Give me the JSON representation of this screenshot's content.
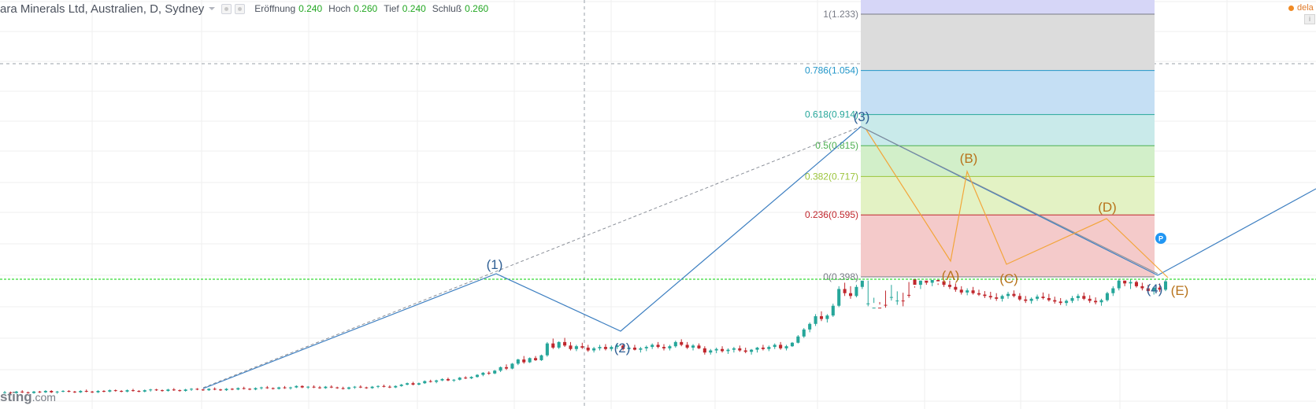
{
  "header": {
    "title": "ara Minerals Ltd, Australien, D, Sydney",
    "ohlc": [
      {
        "label": "Eröffnung",
        "value": "0.240"
      },
      {
        "label": "Hoch",
        "value": "0.260"
      },
      {
        "label": "Tief",
        "value": "0.240"
      },
      {
        "label": "Schluß",
        "value": "0.260"
      }
    ],
    "delay_text": "dela",
    "corner_icon": "info-icon"
  },
  "watermark": {
    "brand": "sting",
    "domain": ".com"
  },
  "colors": {
    "up": "#26a69a",
    "down": "#c0272d",
    "elliott": "#3d7fc1",
    "abcde": "#f3a53a",
    "price_line": "#00d000",
    "label_wave": "#2f5f94",
    "label_abcde": "#b8731b"
  },
  "chart_data": {
    "type": "candlestick",
    "price_axis": {
      "min": 0.0,
      "max": 1.3
    },
    "current_price": 0.26,
    "fibonacci": {
      "levels": [
        {
          "ratio": "1",
          "price": "1.233",
          "label": "1(1.233)",
          "color": "#787b86",
          "band": "#dcdcdc"
        },
        {
          "ratio": "0.786",
          "price": "1.054",
          "label": "0.786(1.054)",
          "color": "#2196c9",
          "band": "#c5dff4"
        },
        {
          "ratio": "0.618",
          "price": "0.914",
          "label": "0.618(0.914)",
          "color": "#26a69a",
          "band": "#c9eaea"
        },
        {
          "ratio": "0.5",
          "price": "0.815",
          "label": "0.5(0.815)",
          "color": "#4caf50",
          "band": "#d2efc9"
        },
        {
          "ratio": "0.382",
          "price": "0.717",
          "label": "0.382(0.717)",
          "color": "#9bc43b",
          "band": "#e3f2c4"
        },
        {
          "ratio": "0.236",
          "price": "0.595",
          "label": "0.236(0.595)",
          "color": "#c0272d",
          "band": "#f4caca"
        },
        {
          "ratio": "0",
          "price": "0.398",
          "label": "0(0.398)",
          "color": "#787b86",
          "band": ""
        }
      ],
      "top_band_color": "#d6d6f7"
    },
    "elliott_labels": [
      "(1)",
      "(2)",
      "(3)",
      "(4)"
    ],
    "abcde_labels": [
      "(A)",
      "(B)",
      "(C)",
      "(D)",
      "(E)"
    ],
    "marker": "P",
    "candles": [
      [
        0.098,
        0.1,
        0.096,
        0.098
      ],
      [
        0.098,
        0.099,
        0.095,
        0.097
      ],
      [
        0.097,
        0.1,
        0.096,
        0.099
      ],
      [
        0.099,
        0.101,
        0.097,
        0.098
      ],
      [
        0.098,
        0.099,
        0.096,
        0.097
      ],
      [
        0.097,
        0.1,
        0.096,
        0.099
      ],
      [
        0.099,
        0.1,
        0.097,
        0.098
      ],
      [
        0.098,
        0.101,
        0.097,
        0.1
      ],
      [
        0.1,
        0.101,
        0.097,
        0.098
      ],
      [
        0.098,
        0.1,
        0.096,
        0.099
      ],
      [
        0.099,
        0.101,
        0.098,
        0.1
      ],
      [
        0.1,
        0.101,
        0.098,
        0.099
      ],
      [
        0.099,
        0.1,
        0.097,
        0.098
      ],
      [
        0.098,
        0.101,
        0.097,
        0.1
      ],
      [
        0.1,
        0.102,
        0.098,
        0.099
      ],
      [
        0.099,
        0.1,
        0.097,
        0.098
      ],
      [
        0.098,
        0.101,
        0.097,
        0.1
      ],
      [
        0.1,
        0.101,
        0.098,
        0.099
      ],
      [
        0.099,
        0.102,
        0.098,
        0.101
      ],
      [
        0.101,
        0.102,
        0.099,
        0.1
      ],
      [
        0.1,
        0.101,
        0.098,
        0.099
      ],
      [
        0.099,
        0.102,
        0.098,
        0.101
      ],
      [
        0.101,
        0.103,
        0.099,
        0.1
      ],
      [
        0.1,
        0.101,
        0.098,
        0.099
      ],
      [
        0.099,
        0.102,
        0.098,
        0.101
      ],
      [
        0.101,
        0.103,
        0.099,
        0.102
      ],
      [
        0.102,
        0.103,
        0.1,
        0.101
      ],
      [
        0.101,
        0.102,
        0.099,
        0.1
      ],
      [
        0.1,
        0.103,
        0.099,
        0.102
      ],
      [
        0.102,
        0.104,
        0.1,
        0.101
      ],
      [
        0.101,
        0.102,
        0.099,
        0.1
      ],
      [
        0.1,
        0.103,
        0.099,
        0.102
      ],
      [
        0.102,
        0.104,
        0.1,
        0.103
      ],
      [
        0.103,
        0.104,
        0.101,
        0.102
      ],
      [
        0.102,
        0.103,
        0.1,
        0.101
      ],
      [
        0.101,
        0.104,
        0.1,
        0.103
      ],
      [
        0.103,
        0.105,
        0.101,
        0.102
      ],
      [
        0.102,
        0.103,
        0.1,
        0.101
      ],
      [
        0.101,
        0.104,
        0.1,
        0.103
      ],
      [
        0.103,
        0.104,
        0.101,
        0.102
      ],
      [
        0.102,
        0.105,
        0.101,
        0.104
      ],
      [
        0.104,
        0.106,
        0.102,
        0.103
      ],
      [
        0.103,
        0.104,
        0.101,
        0.102
      ],
      [
        0.102,
        0.105,
        0.101,
        0.104
      ],
      [
        0.104,
        0.106,
        0.102,
        0.105
      ],
      [
        0.105,
        0.107,
        0.103,
        0.104
      ],
      [
        0.104,
        0.105,
        0.102,
        0.103
      ],
      [
        0.103,
        0.106,
        0.102,
        0.105
      ],
      [
        0.105,
        0.107,
        0.103,
        0.104
      ],
      [
        0.104,
        0.106,
        0.102,
        0.105
      ],
      [
        0.105,
        0.108,
        0.104,
        0.107
      ],
      [
        0.107,
        0.108,
        0.104,
        0.105
      ],
      [
        0.105,
        0.107,
        0.103,
        0.106
      ],
      [
        0.106,
        0.108,
        0.104,
        0.105
      ],
      [
        0.105,
        0.107,
        0.103,
        0.104
      ],
      [
        0.104,
        0.107,
        0.103,
        0.106
      ],
      [
        0.106,
        0.108,
        0.104,
        0.105
      ],
      [
        0.105,
        0.106,
        0.103,
        0.104
      ],
      [
        0.104,
        0.106,
        0.102,
        0.103
      ],
      [
        0.103,
        0.106,
        0.102,
        0.105
      ],
      [
        0.105,
        0.107,
        0.103,
        0.106
      ],
      [
        0.106,
        0.108,
        0.104,
        0.105
      ],
      [
        0.105,
        0.106,
        0.103,
        0.104
      ],
      [
        0.104,
        0.107,
        0.103,
        0.106
      ],
      [
        0.106,
        0.108,
        0.104,
        0.107
      ],
      [
        0.107,
        0.109,
        0.105,
        0.106
      ],
      [
        0.106,
        0.108,
        0.104,
        0.105
      ],
      [
        0.105,
        0.108,
        0.104,
        0.107
      ],
      [
        0.107,
        0.11,
        0.106,
        0.109
      ],
      [
        0.109,
        0.112,
        0.108,
        0.111
      ],
      [
        0.111,
        0.113,
        0.108,
        0.109
      ],
      [
        0.109,
        0.112,
        0.108,
        0.111
      ],
      [
        0.111,
        0.115,
        0.11,
        0.114
      ],
      [
        0.114,
        0.116,
        0.112,
        0.113
      ],
      [
        0.113,
        0.116,
        0.111,
        0.115
      ],
      [
        0.115,
        0.118,
        0.114,
        0.117
      ],
      [
        0.117,
        0.119,
        0.114,
        0.115
      ],
      [
        0.115,
        0.117,
        0.113,
        0.116
      ],
      [
        0.116,
        0.12,
        0.115,
        0.119
      ],
      [
        0.119,
        0.121,
        0.117,
        0.118
      ],
      [
        0.118,
        0.121,
        0.117,
        0.12
      ],
      [
        0.12,
        0.124,
        0.119,
        0.123
      ],
      [
        0.123,
        0.127,
        0.121,
        0.126
      ],
      [
        0.126,
        0.128,
        0.123,
        0.125
      ],
      [
        0.125,
        0.13,
        0.124,
        0.129
      ],
      [
        0.129,
        0.135,
        0.127,
        0.134
      ],
      [
        0.134,
        0.138,
        0.13,
        0.132
      ],
      [
        0.132,
        0.14,
        0.131,
        0.139
      ],
      [
        0.139,
        0.146,
        0.137,
        0.145
      ],
      [
        0.145,
        0.15,
        0.139,
        0.141
      ],
      [
        0.141,
        0.148,
        0.14,
        0.147
      ],
      [
        0.147,
        0.15,
        0.143,
        0.144
      ],
      [
        0.144,
        0.152,
        0.143,
        0.151
      ],
      [
        0.151,
        0.17,
        0.149,
        0.168
      ],
      [
        0.168,
        0.175,
        0.16,
        0.162
      ],
      [
        0.162,
        0.171,
        0.16,
        0.17
      ],
      [
        0.17,
        0.176,
        0.163,
        0.165
      ],
      [
        0.165,
        0.17,
        0.158,
        0.16
      ],
      [
        0.16,
        0.166,
        0.157,
        0.164
      ],
      [
        0.164,
        0.169,
        0.16,
        0.162
      ],
      [
        0.162,
        0.166,
        0.156,
        0.158
      ],
      [
        0.158,
        0.163,
        0.155,
        0.161
      ],
      [
        0.161,
        0.166,
        0.158,
        0.163
      ],
      [
        0.163,
        0.167,
        0.158,
        0.16
      ],
      [
        0.16,
        0.165,
        0.157,
        0.163
      ],
      [
        0.163,
        0.168,
        0.16,
        0.165
      ],
      [
        0.165,
        0.168,
        0.158,
        0.16
      ],
      [
        0.16,
        0.164,
        0.156,
        0.162
      ],
      [
        0.162,
        0.166,
        0.158,
        0.159
      ],
      [
        0.159,
        0.163,
        0.155,
        0.161
      ],
      [
        0.161,
        0.165,
        0.157,
        0.163
      ],
      [
        0.163,
        0.168,
        0.16,
        0.166
      ],
      [
        0.166,
        0.17,
        0.161,
        0.163
      ],
      [
        0.163,
        0.167,
        0.158,
        0.161
      ],
      [
        0.161,
        0.166,
        0.158,
        0.164
      ],
      [
        0.164,
        0.172,
        0.162,
        0.17
      ],
      [
        0.17,
        0.174,
        0.164,
        0.166
      ],
      [
        0.166,
        0.17,
        0.16,
        0.162
      ],
      [
        0.162,
        0.167,
        0.158,
        0.165
      ],
      [
        0.165,
        0.168,
        0.16,
        0.161
      ],
      [
        0.161,
        0.164,
        0.152,
        0.155
      ],
      [
        0.155,
        0.16,
        0.152,
        0.158
      ],
      [
        0.158,
        0.162,
        0.154,
        0.16
      ],
      [
        0.16,
        0.164,
        0.155,
        0.157
      ],
      [
        0.157,
        0.161,
        0.153,
        0.159
      ],
      [
        0.159,
        0.163,
        0.155,
        0.161
      ],
      [
        0.161,
        0.165,
        0.156,
        0.158
      ],
      [
        0.158,
        0.162,
        0.154,
        0.156
      ],
      [
        0.156,
        0.16,
        0.152,
        0.159
      ],
      [
        0.159,
        0.163,
        0.155,
        0.162
      ],
      [
        0.162,
        0.166,
        0.158,
        0.16
      ],
      [
        0.16,
        0.165,
        0.157,
        0.163
      ],
      [
        0.163,
        0.168,
        0.16,
        0.166
      ],
      [
        0.166,
        0.17,
        0.159,
        0.161
      ],
      [
        0.161,
        0.166,
        0.158,
        0.164
      ],
      [
        0.164,
        0.17,
        0.163,
        0.169
      ],
      [
        0.169,
        0.18,
        0.168,
        0.178
      ],
      [
        0.178,
        0.19,
        0.176,
        0.188
      ],
      [
        0.188,
        0.198,
        0.184,
        0.196
      ],
      [
        0.196,
        0.21,
        0.193,
        0.207
      ],
      [
        0.207,
        0.214,
        0.2,
        0.203
      ],
      [
        0.203,
        0.21,
        0.198,
        0.208
      ],
      [
        0.208,
        0.225,
        0.206,
        0.222
      ],
      [
        0.222,
        0.25,
        0.22,
        0.246
      ],
      [
        0.246,
        0.255,
        0.236,
        0.24
      ],
      [
        0.24,
        0.25,
        0.232,
        0.236
      ],
      [
        0.236,
        0.252,
        0.234,
        0.249
      ],
      [
        0.249,
        0.265,
        0.246,
        0.262
      ],
      [
        0.262,
        0.298,
        0.258,
        0.294
      ],
      [
        0.294,
        0.315,
        0.286,
        0.3
      ],
      [
        0.3,
        0.31,
        0.292,
        0.296
      ],
      [
        0.296,
        0.3,
        0.276,
        0.279
      ],
      [
        0.279,
        0.29,
        0.268,
        0.285
      ],
      [
        0.285,
        0.296,
        0.277,
        0.29
      ],
      [
        0.29,
        0.298,
        0.279,
        0.282
      ],
      [
        0.282,
        0.286,
        0.256,
        0.26
      ],
      [
        0.26,
        0.27,
        0.248,
        0.252
      ],
      [
        0.252,
        0.262,
        0.246,
        0.258
      ],
      [
        0.258,
        0.265,
        0.252,
        0.255
      ],
      [
        0.255,
        0.264,
        0.25,
        0.261
      ],
      [
        0.261,
        0.268,
        0.254,
        0.257
      ],
      [
        0.257,
        0.262,
        0.249,
        0.252
      ],
      [
        0.252,
        0.258,
        0.246,
        0.249
      ],
      [
        0.249,
        0.254,
        0.242,
        0.245
      ],
      [
        0.245,
        0.25,
        0.238,
        0.241
      ],
      [
        0.241,
        0.247,
        0.237,
        0.244
      ],
      [
        0.244,
        0.249,
        0.238,
        0.24
      ],
      [
        0.24,
        0.245,
        0.236,
        0.238
      ],
      [
        0.238,
        0.243,
        0.233,
        0.236
      ],
      [
        0.236,
        0.242,
        0.231,
        0.234
      ],
      [
        0.234,
        0.24,
        0.229,
        0.232
      ],
      [
        0.232,
        0.238,
        0.228,
        0.236
      ],
      [
        0.236,
        0.242,
        0.232,
        0.239
      ],
      [
        0.239,
        0.244,
        0.234,
        0.236
      ],
      [
        0.236,
        0.24,
        0.229,
        0.231
      ],
      [
        0.231,
        0.236,
        0.226,
        0.229
      ],
      [
        0.229,
        0.234,
        0.225,
        0.232
      ],
      [
        0.232,
        0.238,
        0.229,
        0.235
      ],
      [
        0.235,
        0.241,
        0.231,
        0.233
      ],
      [
        0.233,
        0.239,
        0.228,
        0.23
      ],
      [
        0.23,
        0.235,
        0.225,
        0.228
      ],
      [
        0.228,
        0.233,
        0.223,
        0.226
      ],
      [
        0.226,
        0.231,
        0.222,
        0.229
      ],
      [
        0.229,
        0.236,
        0.226,
        0.233
      ],
      [
        0.233,
        0.239,
        0.229,
        0.236
      ],
      [
        0.236,
        0.241,
        0.23,
        0.232
      ],
      [
        0.232,
        0.237,
        0.226,
        0.229
      ],
      [
        0.229,
        0.234,
        0.224,
        0.227
      ],
      [
        0.227,
        0.232,
        0.222,
        0.23
      ],
      [
        0.23,
        0.242,
        0.228,
        0.24
      ],
      [
        0.24,
        0.25,
        0.236,
        0.247
      ],
      [
        0.247,
        0.26,
        0.244,
        0.258
      ],
      [
        0.258,
        0.262,
        0.25,
        0.254
      ],
      [
        0.254,
        0.26,
        0.246,
        0.256
      ],
      [
        0.256,
        0.262,
        0.248,
        0.25
      ],
      [
        0.25,
        0.255,
        0.244,
        0.247
      ],
      [
        0.247,
        0.252,
        0.24,
        0.243
      ],
      [
        0.243,
        0.25,
        0.238,
        0.248
      ],
      [
        0.248,
        0.254,
        0.242,
        0.245
      ],
      [
        0.245,
        0.26,
        0.243,
        0.257
      ]
    ]
  }
}
